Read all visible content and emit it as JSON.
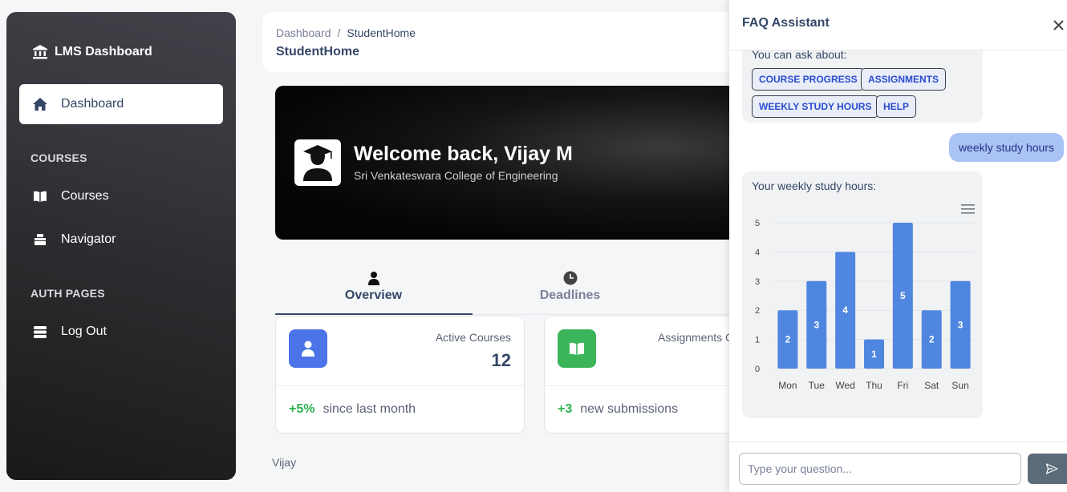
{
  "sidebar": {
    "brand": "LMS Dashboard",
    "items": [
      {
        "label": "Dashboard"
      },
      {
        "label": "Courses"
      },
      {
        "label": "Navigator"
      },
      {
        "label": "Log Out"
      }
    ],
    "sections": {
      "courses": "COURSES",
      "auth": "AUTH PAGES"
    }
  },
  "header": {
    "breadcrumb_root": "Dashboard",
    "breadcrumb_sep": "/",
    "breadcrumb_current": "StudentHome",
    "title": "StudentHome"
  },
  "banner": {
    "welcome": "Welcome back, Vijay M",
    "college": "Sri Venkateswara College of Engineering"
  },
  "tabs": [
    {
      "label": "Overview",
      "active": true
    },
    {
      "label": "Deadlines",
      "active": false
    }
  ],
  "stats": [
    {
      "label": "Active Courses",
      "value": "12",
      "delta": "+5%",
      "note": "since last month",
      "color": "#4a74e8"
    },
    {
      "label": "Assignments C",
      "value": "",
      "delta": "+3",
      "note": "new submissions",
      "color": "#3cb55a"
    }
  ],
  "footer_user": "Vijay",
  "faq": {
    "title": "FAQ Assistant",
    "intro": "You can ask about:",
    "chips": [
      "COURSE PROGRESS",
      "ASSIGNMENTS",
      "WEEKLY STUDY HOURS",
      "HELP"
    ],
    "user_message": "weekly study hours",
    "reply": "Your weekly study hours:",
    "input_placeholder": "Type your question..."
  },
  "chart_data": {
    "type": "bar",
    "categories": [
      "Mon",
      "Tue",
      "Wed",
      "Thu",
      "Fri",
      "Sat",
      "Sun"
    ],
    "values": [
      2,
      3,
      4,
      1,
      5,
      2,
      3
    ],
    "ylim": [
      0,
      5
    ],
    "yticks": [
      0,
      1,
      2,
      3,
      4,
      5
    ],
    "grid": true,
    "bar_color": "#4f86e0",
    "data_labels": true
  }
}
